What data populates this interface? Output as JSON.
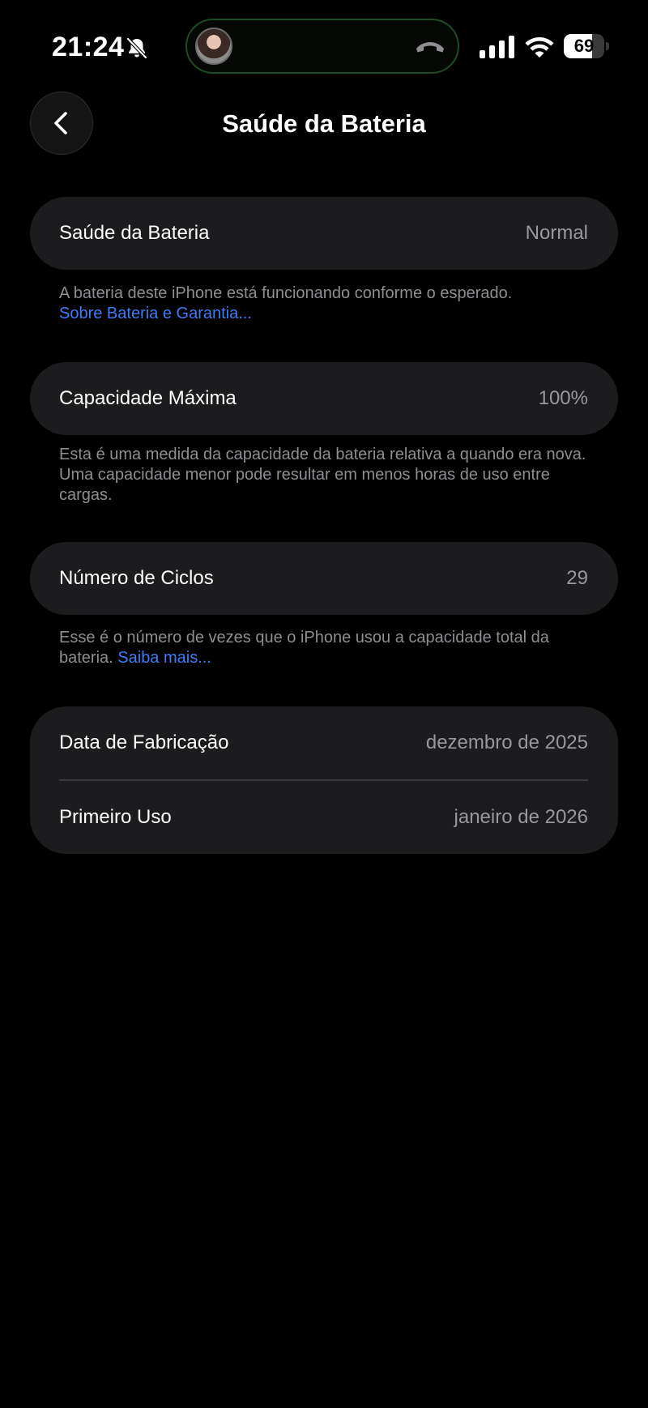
{
  "status_bar": {
    "time": "21:24",
    "battery_level": "69",
    "battery_fraction": 0.69,
    "icons": [
      "bell-slash-icon",
      "avatar",
      "phone-end-icon",
      "cellular-signal-icon",
      "wifi-icon",
      "battery-icon"
    ]
  },
  "nav": {
    "title": "Saúde da Bateria",
    "back_icon": "chevron-left-icon"
  },
  "battery_health": {
    "label": "Saúde da Bateria",
    "value": "Normal",
    "footnote": "A bateria deste iPhone está funcionando conforme o esperado.",
    "link": "Sobre Bateria e Garantia..."
  },
  "max_capacity": {
    "label": "Capacidade Máxima",
    "value": "100%",
    "footnote": "Esta é uma medida da capacidade da bateria relativa a quando era nova. Uma capacidade menor pode resultar em menos horas de uso entre cargas."
  },
  "cycle_count": {
    "label": "Número de Ciclos",
    "value": "29",
    "footnote": "Esse é o número de vezes que o iPhone usou a capacidade total da bateria.",
    "link": "Saiba mais..."
  },
  "dates": {
    "manufacture_label": "Data de Fabricação",
    "manufacture_value": "dezembro de 2025",
    "first_use_label": "Primeiro Uso",
    "first_use_value": "janeiro de 2026"
  },
  "colors": {
    "background": "#000000",
    "card": "#1c1c1e",
    "secondary_text": "#98989d",
    "link": "#3f7bf6",
    "island_border": "#1f4a23"
  }
}
